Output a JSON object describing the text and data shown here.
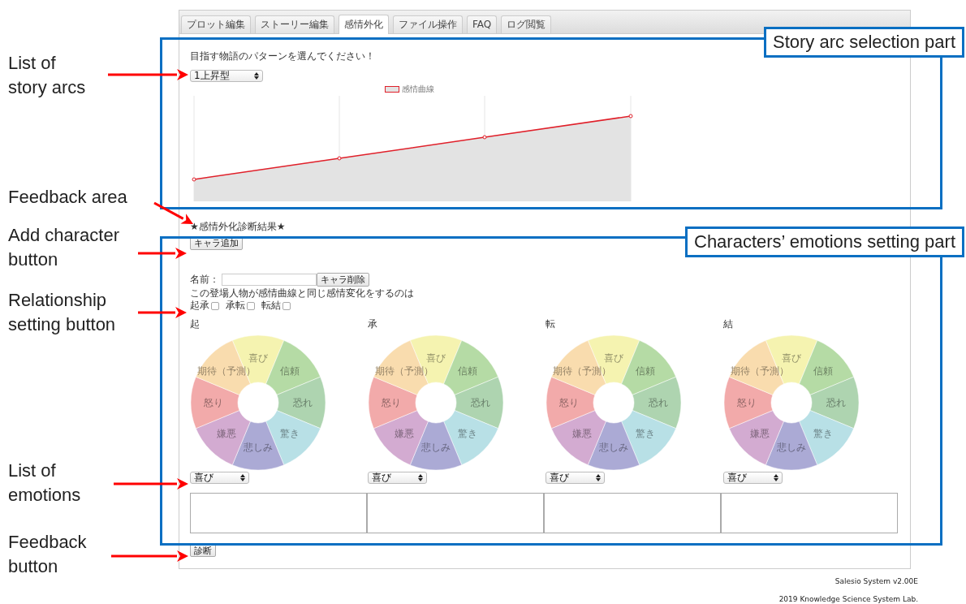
{
  "tabs": [
    {
      "label": "プロット編集",
      "selected": false
    },
    {
      "label": "ストーリー編集",
      "selected": false
    },
    {
      "label": "感情外化",
      "selected": true
    },
    {
      "label": "ファイル操作",
      "selected": false
    },
    {
      "label": "FAQ",
      "selected": false
    },
    {
      "label": "ログ閲覧",
      "selected": false
    }
  ],
  "story_arc": {
    "prompt": "目指す物語のパターンを選んでください！",
    "select_value": "1上昇型",
    "chart_legend": "感情曲線"
  },
  "feedback_heading": "★感情外化診断結果★",
  "add_character_button": "キャラ追加",
  "character": {
    "name_label": "名前：",
    "delete_button": "キャラ削除",
    "relationship_prompt": "この登場人物が感情曲線と同じ感情変化をするのは",
    "relationships": [
      {
        "label": "起承",
        "checked": false
      },
      {
        "label": "承転",
        "checked": false
      },
      {
        "label": "転結",
        "checked": false
      }
    ],
    "phases": [
      {
        "label": "起",
        "select_value": "喜び",
        "segments": [
          {
            "label": "喜び",
            "color": "#f5f3b0"
          },
          {
            "label": "信頼",
            "color": "#b5dba5"
          },
          {
            "label": "恐れ",
            "color": "#aed4b0"
          },
          {
            "label": "驚き",
            "color": "#b8e0e6"
          },
          {
            "label": "悲しみ",
            "color": "#abaad5"
          },
          {
            "label": "嫌悪",
            "color": "#d3abd1"
          },
          {
            "label": "怒り",
            "color": "#f2aaaa"
          },
          {
            "label": "期待（予測）",
            "color": "#f9dcae"
          }
        ]
      },
      {
        "label": "承",
        "select_value": "喜び",
        "segments": [
          {
            "label": "喜び",
            "color": "#f5f3b0"
          },
          {
            "label": "信頼",
            "color": "#b5dba5"
          },
          {
            "label": "恐れ",
            "color": "#aed4b0"
          },
          {
            "label": "驚き",
            "color": "#b8e0e6"
          },
          {
            "label": "悲しみ",
            "color": "#abaad5"
          },
          {
            "label": "嫌悪",
            "color": "#d3abd1"
          },
          {
            "label": "怒り",
            "color": "#f2aaaa"
          },
          {
            "label": "期待（予測）",
            "color": "#f9dcae"
          }
        ]
      },
      {
        "label": "転",
        "select_value": "喜び",
        "segments": [
          {
            "label": "喜び",
            "color": "#f5f3b0"
          },
          {
            "label": "信頼",
            "color": "#b5dba5"
          },
          {
            "label": "恐れ",
            "color": "#aed4b0"
          },
          {
            "label": "驚き",
            "color": "#b8e0e6"
          },
          {
            "label": "悲しみ",
            "color": "#abaad5"
          },
          {
            "label": "嫌悪",
            "color": "#d3abd1"
          },
          {
            "label": "怒り",
            "color": "#f2aaaa"
          },
          {
            "label": "期待（予測）",
            "color": "#f9dcae"
          }
        ]
      },
      {
        "label": "結",
        "select_value": "喜び",
        "segments": [
          {
            "label": "喜び",
            "color": "#f5f3b0"
          },
          {
            "label": "信頼",
            "color": "#b5dba5"
          },
          {
            "label": "恐れ",
            "color": "#aed4b0"
          },
          {
            "label": "驚き",
            "color": "#b8e0e6"
          },
          {
            "label": "悲しみ",
            "color": "#abaad5"
          },
          {
            "label": "嫌悪",
            "color": "#d3abd1"
          },
          {
            "label": "怒り",
            "color": "#f2aaaa"
          },
          {
            "label": "期待（予測）",
            "color": "#f9dcae"
          }
        ]
      }
    ]
  },
  "diagnose_button": "診断",
  "footer": [
    "Salesio System v2.00E",
    "2019 Knowledge Science System Lab."
  ],
  "annotations": {
    "sections": [
      {
        "title": "Story arc selection part"
      },
      {
        "title": "Characters’ emotions setting part"
      }
    ],
    "callouts": [
      {
        "text": "List of\nstory arcs"
      },
      {
        "text": "Feedback area"
      },
      {
        "text": "Add character\nbutton"
      },
      {
        "text": "Relationship\nsetting button"
      },
      {
        "text": "List of\nemotions"
      },
      {
        "text": "Feedback\nbutton"
      }
    ]
  }
}
